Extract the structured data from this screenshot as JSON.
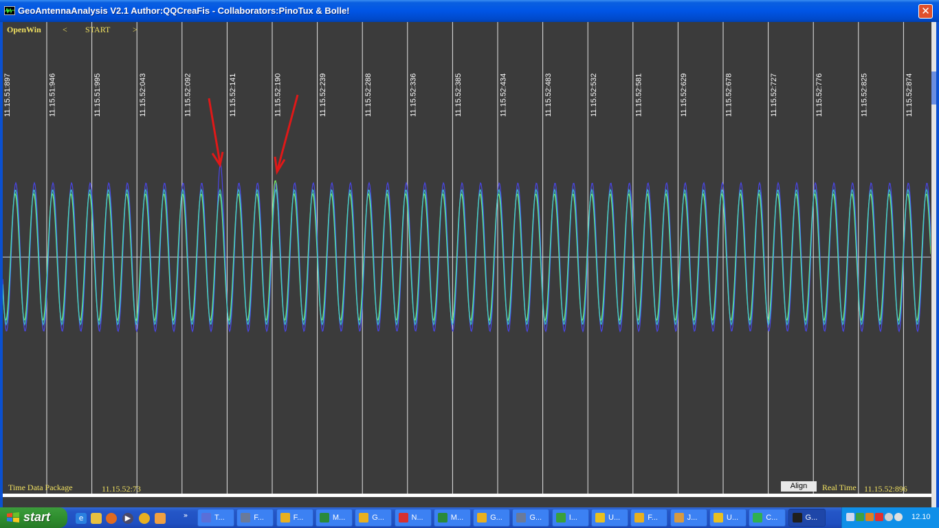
{
  "window": {
    "title": "GeoAntennaAnalysis V2.1 Author:QQCreaFis - Collaborators:PinoTux & Bolle!",
    "close_glyph": "✕"
  },
  "controls": {
    "openwin": "OpenWin",
    "prev": "<",
    "start": "START",
    "next": ">"
  },
  "footer": {
    "time_data_package_label": "Time Data Package",
    "time_data_package_value": "11.15.52:73",
    "align_button": "Align",
    "real_time_label": "Real Time",
    "real_time_value": "11.15.52:896"
  },
  "timeline": {
    "labels": [
      "11.15.51:897",
      "11.15.51:946",
      "11.15.51:995",
      "11.15.52:043",
      "11.15.52:092",
      "11.15.52:141",
      "11.15.52:190",
      "11.15.52:239",
      "11.15.52:288",
      "11.15.52:336",
      "11.15.52:385",
      "11.15.52:434",
      "11.15.52:483",
      "11.15.52:532",
      "11.15.52:581",
      "11.15.52:629",
      "11.15.52:678",
      "11.15.52:727",
      "11.15.52:776",
      "11.15.52:825",
      "11.15.52:874"
    ],
    "colors": {
      "background": "#3b3b3b",
      "gridline": "#e8e8e8",
      "signal_blue": "#4a46e8",
      "signal_green": "#7cf06a",
      "signal_cyan": "#3ec8d8",
      "annotation_arrow": "#e01818"
    },
    "annotations": [
      "red-arrow-blue-peak",
      "red-arrow-green-peak"
    ]
  },
  "taskbar": {
    "start_label": "start",
    "overflow": "»",
    "tasks": [
      {
        "label": "T...",
        "icon": "floppy-disk-icon",
        "color": "#5a6fd8"
      },
      {
        "label": "F...",
        "icon": "paint-tool-icon",
        "color": "#6a7a9a"
      },
      {
        "label": "F...",
        "icon": "chrome-icon",
        "color": "#e8b020"
      },
      {
        "label": "M...",
        "icon": "excel-icon",
        "color": "#2a8a3a"
      },
      {
        "label": "G...",
        "icon": "chrome-icon",
        "color": "#e8b020"
      },
      {
        "label": "N...",
        "icon": "pdf-icon",
        "color": "#d83030"
      },
      {
        "label": "M...",
        "icon": "excel-icon",
        "color": "#2a8a3a"
      },
      {
        "label": "G...",
        "icon": "chrome-icon",
        "color": "#e8b020"
      },
      {
        "label": "G...",
        "icon": "paint-tool-icon",
        "color": "#6a7a9a"
      },
      {
        "label": "I...",
        "icon": "image-viewer-icon",
        "color": "#3aa03a"
      },
      {
        "label": "U...",
        "icon": "sun-icon",
        "color": "#e8c020"
      },
      {
        "label": "F...",
        "icon": "chrome-icon",
        "color": "#e8b020"
      },
      {
        "label": "J...",
        "icon": "paint-palette-icon",
        "color": "#d89a40"
      },
      {
        "label": "U...",
        "icon": "sun-icon",
        "color": "#e8c020"
      },
      {
        "label": "C...",
        "icon": "wireless-icon",
        "color": "#30b050"
      },
      {
        "label": "G...",
        "icon": "geoantenna-icon",
        "color": "#202020",
        "active": true
      }
    ],
    "clock": "12.10"
  }
}
